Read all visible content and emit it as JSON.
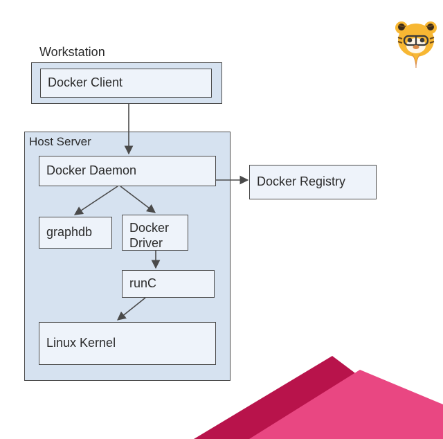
{
  "diagram": {
    "workstation_label": "Workstation",
    "host_label": "Host Server",
    "client": "Docker Client",
    "daemon": "Docker Daemon",
    "registry": "Docker Registry",
    "graphdb": "graphdb",
    "driver": "Docker\nDriver",
    "runc": "runC",
    "kernel": "Linux Kernel"
  }
}
